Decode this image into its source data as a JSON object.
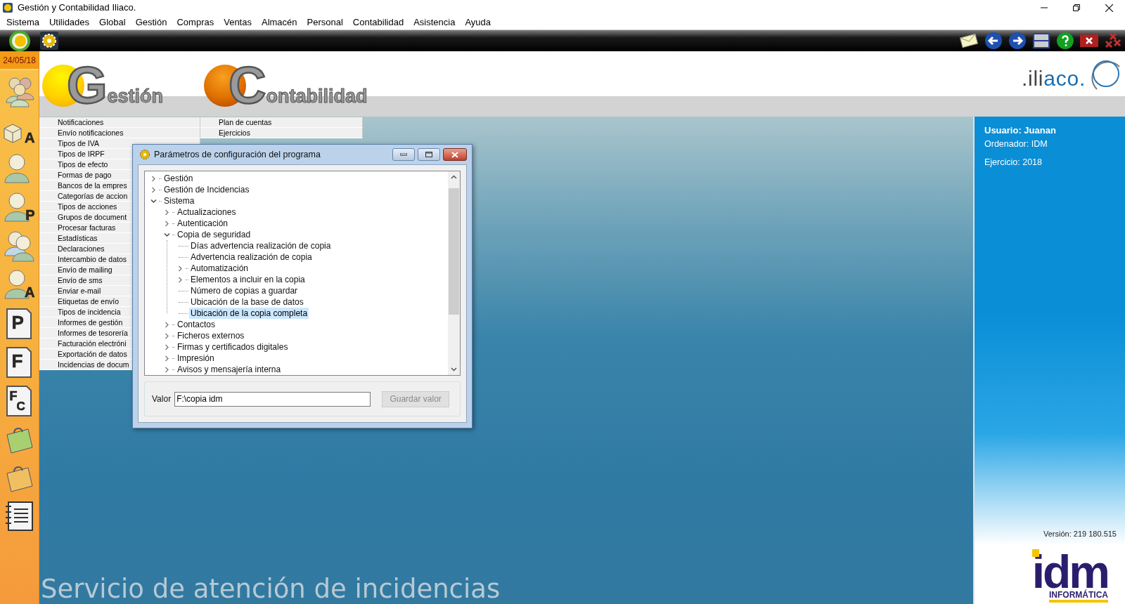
{
  "window": {
    "title": "Gestión y Contabilidad Iliaco."
  },
  "menu": [
    "Sistema",
    "Utilidades",
    "Global",
    "Gestión",
    "Compras",
    "Ventas",
    "Almacén",
    "Personal",
    "Contabilidad",
    "Asistencia",
    "Ayuda"
  ],
  "date": "24/05/18",
  "sidebar": [
    {
      "kind": "people"
    },
    {
      "kind": "boxes",
      "letter": "A"
    },
    {
      "kind": "person"
    },
    {
      "kind": "person",
      "letter": "P"
    },
    {
      "kind": "two_persons"
    },
    {
      "kind": "person",
      "letter": "A"
    },
    {
      "kind": "document",
      "letter": "P"
    },
    {
      "kind": "document",
      "letter": "F"
    },
    {
      "kind": "document_pair",
      "letter": "F",
      "letter_2": "C"
    },
    {
      "kind": "bag_green"
    },
    {
      "kind": "bag_orange"
    },
    {
      "kind": "notebook"
    }
  ],
  "header": {
    "logos": [
      {
        "initial": "G",
        "rest": "estión",
        "kind": "yellow"
      },
      {
        "initial": "C",
        "rest": "ontabilidad",
        "kind": "orange"
      }
    ],
    "brand": {
      "dark": ".ili",
      "blue": "aco."
    }
  },
  "list": {
    "column_1": [
      "Notificaciones",
      "Envío notificaciones",
      "Tipos de IVA",
      "Tipos de IRPF",
      "Tipos de efecto",
      "Formas de pago",
      "Bancos de la empres",
      "Categorías de accion",
      "Tipos de acciones",
      "Grupos de document",
      "Procesar facturas",
      "Estadísticas",
      "Declaraciones",
      "Intercambio de datos",
      "Envío de mailing",
      "Envío de sms",
      "Enviar e-mail",
      "Etiquetas de envío",
      "Tipos de incidencia",
      "Informes de gestión",
      "Informes de tesorería",
      "Facturación electróni",
      "Exportación de datos",
      "Incidencias de docum"
    ],
    "column_2": [
      "Plan de cuentas",
      "Ejercicios"
    ]
  },
  "dialog": {
    "title": "Parámetros de configuración del programa",
    "tree": [
      {
        "label": "Gestión",
        "kind": "folder",
        "expanded": false,
        "selected": false
      },
      {
        "label": "Gestión de Incidencias",
        "kind": "folder",
        "expanded": false,
        "selected": false
      },
      {
        "label": "Sistema",
        "kind": "folder",
        "expanded": true,
        "selected": false,
        "children": [
          {
            "label": "Actualizaciones",
            "kind": "folder",
            "expanded": false,
            "selected": false
          },
          {
            "label": "Autenticación",
            "kind": "folder",
            "expanded": false,
            "selected": false
          },
          {
            "label": "Copia de seguridad",
            "kind": "folder",
            "expanded": true,
            "selected": false,
            "children": [
              {
                "label": "Días advertencia realización de copia",
                "kind": "leaf",
                "selected": false
              },
              {
                "label": "Advertencia realización de copia",
                "kind": "leaf",
                "selected": false
              },
              {
                "label": "Automatización",
                "kind": "folder",
                "expanded": false,
                "selected": false
              },
              {
                "label": "Elementos a incluir en la copia",
                "kind": "folder",
                "expanded": false,
                "selected": false
              },
              {
                "label": "Número de copias a guardar",
                "kind": "leaf",
                "selected": false
              },
              {
                "label": "Ubicación de la base de datos",
                "kind": "leaf",
                "selected": false
              },
              {
                "label": "Ubicación de la copia completa",
                "kind": "leaf",
                "selected": true
              }
            ]
          },
          {
            "label": "Contactos",
            "kind": "folder",
            "expanded": false,
            "selected": false
          },
          {
            "label": "Ficheros externos",
            "kind": "folder",
            "expanded": false,
            "selected": false
          },
          {
            "label": "Firmas y certificados digitales",
            "kind": "folder",
            "expanded": false,
            "selected": false
          },
          {
            "label": "Impresión",
            "kind": "folder",
            "expanded": false,
            "selected": false
          },
          {
            "label": "Avisos y mensajería interna",
            "kind": "folder",
            "expanded": false,
            "selected": false
          }
        ]
      }
    ],
    "value_label": "Valor",
    "value": "F:\\copia idm",
    "save_button": {
      "label": "Guardar valor",
      "disabled": true
    }
  },
  "info": {
    "user": "Usuario: Juanan",
    "computer": "Ordenador: IDM",
    "year": "Ejercicio: 2018",
    "version": "Versión: 219 180.515"
  },
  "footer_logo": {
    "name": "idm",
    "subtitle": "INFORMÁTICA"
  },
  "banner": "Servicio de atención de incidencias"
}
